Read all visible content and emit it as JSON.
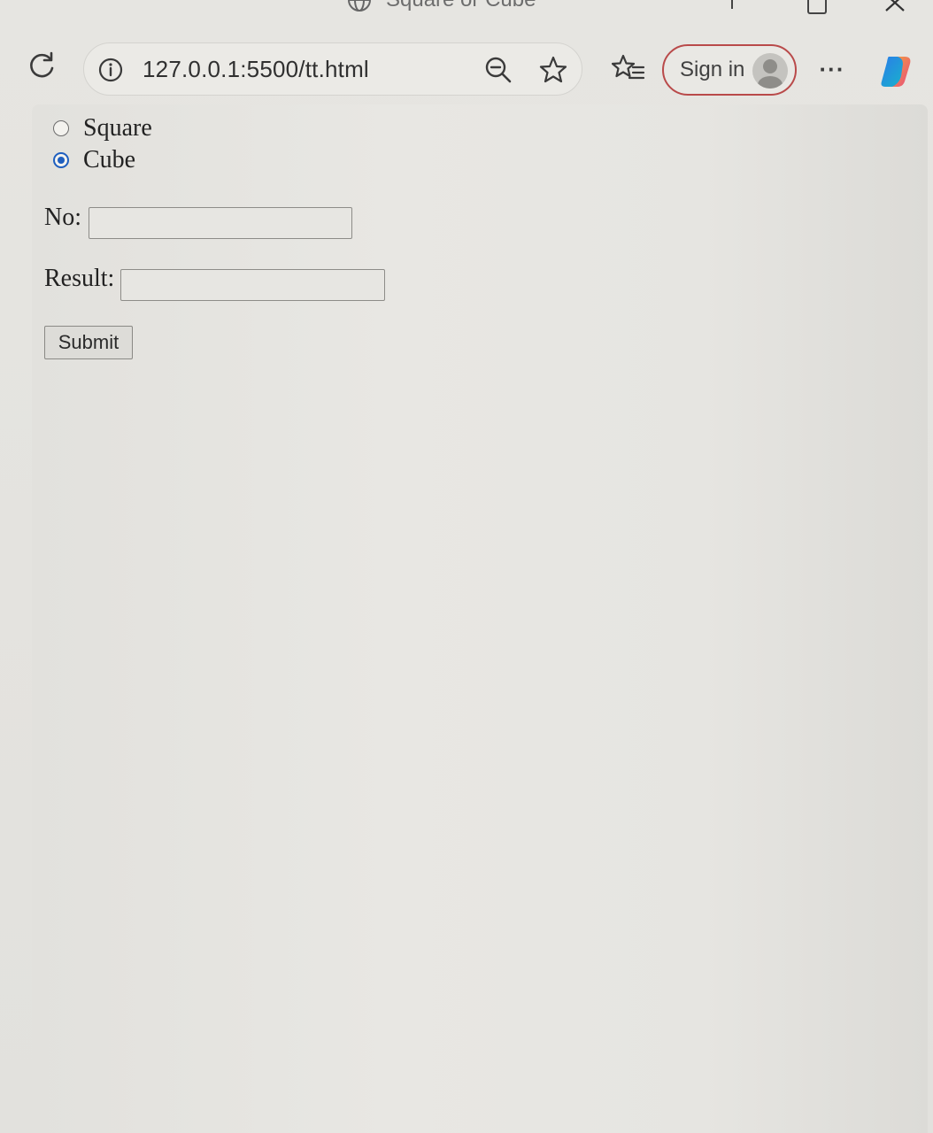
{
  "window": {
    "title": "Square or Cube"
  },
  "toolbar": {
    "url": "127.0.0.1:5500/tt.html",
    "sign_in_label": "Sign in",
    "more_label": "···"
  },
  "form": {
    "radios": [
      {
        "label": "Square",
        "checked": false
      },
      {
        "label": "Cube",
        "checked": true
      }
    ],
    "no_label": "No:",
    "no_value": "",
    "result_label": "Result:",
    "result_value": "",
    "submit_label": "Submit"
  },
  "colors": {
    "accent_radio": "#1f5fbf",
    "signin_border": "#b94a4a"
  }
}
